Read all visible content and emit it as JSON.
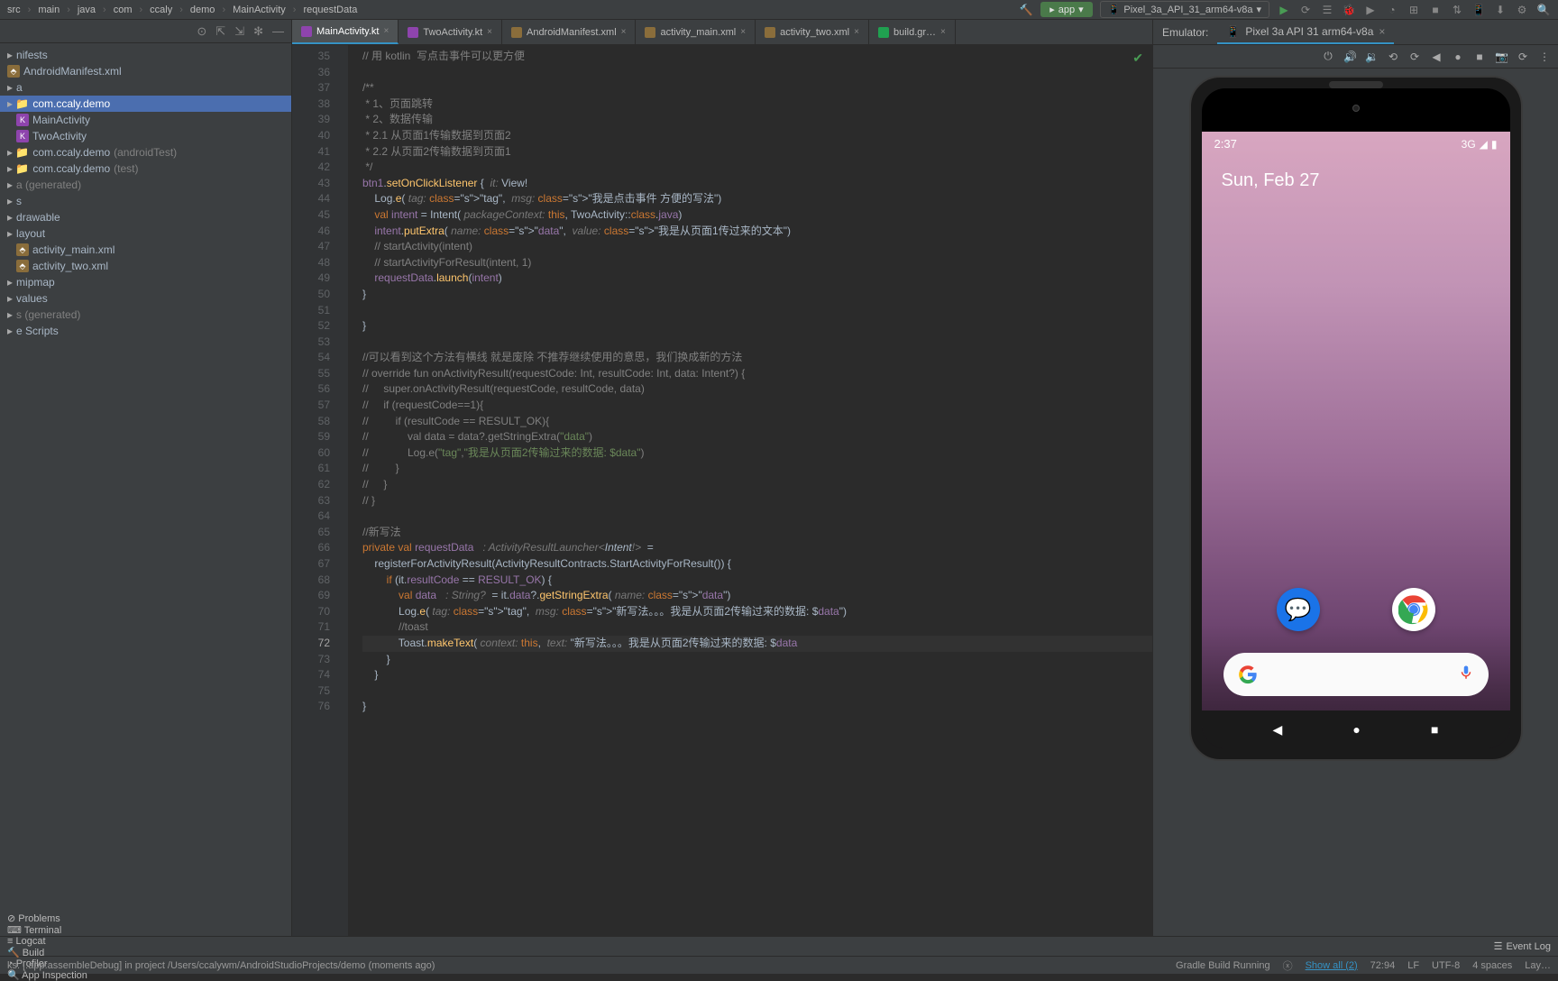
{
  "breadcrumb": [
    "src",
    "main",
    "java",
    "com",
    "ccaly",
    "demo",
    "MainActivity",
    "requestData"
  ],
  "toolbar": {
    "app_config": "app",
    "device": "Pixel_3a_API_31_arm64-v8a"
  },
  "project_tree": [
    {
      "label": "nifests",
      "type": "folder",
      "indent": 0
    },
    {
      "label": "AndroidManifest.xml",
      "type": "xml",
      "indent": 0
    },
    {
      "label": "a",
      "type": "folder",
      "indent": 0
    },
    {
      "label": "com.ccaly.demo",
      "type": "pkg",
      "indent": 0,
      "selected": true
    },
    {
      "label": "MainActivity",
      "type": "kt",
      "indent": 1
    },
    {
      "label": "TwoActivity",
      "type": "kt",
      "indent": 1
    },
    {
      "label": "com.ccaly.demo",
      "suffix": "(androidTest)",
      "type": "pkg",
      "indent": 0
    },
    {
      "label": "com.ccaly.demo",
      "suffix": "(test)",
      "type": "pkg",
      "indent": 0
    },
    {
      "label": "a (generated)",
      "type": "folder-muted",
      "indent": 0
    },
    {
      "label": "s",
      "type": "folder",
      "indent": 0
    },
    {
      "label": "drawable",
      "type": "folder",
      "indent": 0
    },
    {
      "label": "layout",
      "type": "folder",
      "indent": 0
    },
    {
      "label": "activity_main.xml",
      "type": "xml",
      "indent": 1
    },
    {
      "label": "activity_two.xml",
      "type": "xml",
      "indent": 1
    },
    {
      "label": "mipmap",
      "type": "folder",
      "indent": 0
    },
    {
      "label": "values",
      "type": "folder",
      "indent": 0
    },
    {
      "label": "s (generated)",
      "type": "folder-muted",
      "indent": 0
    },
    {
      "label": "e Scripts",
      "type": "folder",
      "indent": 0
    }
  ],
  "editor_tabs": [
    {
      "label": "MainActivity.kt",
      "icon": "kt",
      "active": true
    },
    {
      "label": "TwoActivity.kt",
      "icon": "kt"
    },
    {
      "label": "AndroidManifest.xml",
      "icon": "xml"
    },
    {
      "label": "activity_main.xml",
      "icon": "xml"
    },
    {
      "label": "activity_two.xml",
      "icon": "xml"
    },
    {
      "label": "build.gr…",
      "icon": "gradle"
    }
  ],
  "line_start": 35,
  "line_end": 76,
  "current_line": 72,
  "code_lines": [
    "// 用 kotlin  写点击事件可以更方便",
    "",
    "/**",
    " * 1、页面跳转",
    " * 2、数据传输",
    " * 2.1 从页面1传输数据到页面2",
    " * 2.2 从页面2传输数据到页面1",
    " */",
    "btn1.setOnClickListener {  it: View!",
    "    Log.e( tag: \"tag\",  msg: \"我是点击事件 方便的写法\")",
    "    val intent = Intent( packageContext: this, TwoActivity::class.java)",
    "    intent.putExtra( name: \"data\",  value: \"我是从页面1传过来的文本\")",
    "    // startActivity(intent)",
    "    // startActivityForResult(intent, 1)",
    "    requestData.launch(intent)",
    "}",
    "",
    "}",
    "",
    "//可以看到这个方法有横线 就是废除 不推荐继续使用的意思，我们换成新的方法",
    "// override fun onActivityResult(requestCode: Int, resultCode: Int, data: Intent?) {",
    "//     super.onActivityResult(requestCode, resultCode, data)",
    "//     if (requestCode==1){",
    "//         if (resultCode == RESULT_OK){",
    "//             val data = data?.getStringExtra(\"data\")",
    "//             Log.e(\"tag\",\"我是从页面2传输过来的数据: $data\")",
    "//         }",
    "//     }",
    "// }",
    "",
    "//新写法",
    "private val requestData  : ActivityResultLauncher<Intent!>  =",
    "    registerForActivityResult(ActivityResultContracts.StartActivityForResult()) {",
    "        if (it.resultCode == RESULT_OK) {",
    "            val data  : String?  = it.data?.getStringExtra( name: \"data\")",
    "            Log.e( tag: \"tag\",  msg: \"新写法。。。我是从页面2传输过来的数据: $data\")",
    "            //toast",
    "            Toast.makeText( context: this,  text: \"新写法。。。我是从页面2传输过来的数据: $data",
    "        }",
    "    }",
    "",
    "}"
  ],
  "emulator": {
    "label": "Emulator:",
    "tab": "Pixel 3a API 31 arm64-v8a",
    "time": "2:37",
    "network": "3G",
    "date": "Sun, Feb 27"
  },
  "bottom_tabs": [
    "Problems",
    "Terminal",
    "Logcat",
    "Build",
    "Profiler",
    "App Inspection"
  ],
  "bottom_right": "Event Log",
  "status": {
    "task": "ks: [:app:assembleDebug] in project /Users/ccalywm/AndroidStudioProjects/demo (moments ago)",
    "build": "Gradle Build Running",
    "show_all": "Show all (2)",
    "pos": "72:94",
    "line_sep": "LF",
    "encoding": "UTF-8",
    "indent": "4 spaces",
    "layout": "Lay…"
  }
}
